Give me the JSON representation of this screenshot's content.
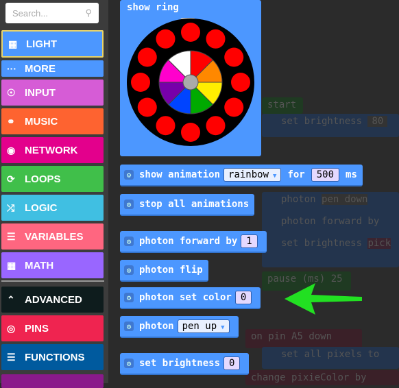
{
  "search": {
    "placeholder": "Search...",
    "icon": "search-icon"
  },
  "categories": [
    {
      "label": "LIGHT",
      "icon": "grid-icon",
      "color": "#4c97ff",
      "selected": true
    },
    {
      "label": "MORE",
      "icon": "more-icon",
      "color": "#4c97ff"
    },
    {
      "label": "INPUT",
      "icon": "target-icon",
      "color": "#d65cd6"
    },
    {
      "label": "MUSIC",
      "icon": "headphones-icon",
      "color": "#fe6330"
    },
    {
      "label": "NETWORK",
      "icon": "chat-icon",
      "color": "#e3008c"
    },
    {
      "label": "LOOPS",
      "icon": "refresh-icon",
      "color": "#40bf4a"
    },
    {
      "label": "LOGIC",
      "icon": "shuffle-icon",
      "color": "#40bfe2"
    },
    {
      "label": "VARIABLES",
      "icon": "list-icon",
      "color": "#ff6680"
    },
    {
      "label": "MATH",
      "icon": "calculator-icon",
      "color": "#9966ff"
    },
    {
      "label": "ADVANCED",
      "icon": "chevron-up-icon",
      "color": "#0e1c1d"
    },
    {
      "label": "PINS",
      "icon": "pins-icon",
      "color": "#ef2450"
    },
    {
      "label": "FUNCTIONS",
      "icon": "functions-icon",
      "color": "#005a9e"
    }
  ],
  "blocks": {
    "show_ring": "show ring",
    "show_animation": {
      "label": "show animation",
      "value": "rainbow",
      "for": "for",
      "ms_value": "500",
      "ms": "ms"
    },
    "stop_all": "stop all animations",
    "forward": {
      "label": "photon forward by",
      "value": "1"
    },
    "flip": "photon flip",
    "set_color": {
      "label": "photon set color",
      "value": "0"
    },
    "pen": {
      "label": "photon",
      "value": "pen up"
    },
    "brightness": {
      "label": "set brightness",
      "value": "0"
    }
  },
  "background_blocks": [
    "start",
    "set brightness",
    "80",
    "photon",
    "pen down",
    "photon forward by",
    "set brightness",
    "pick",
    "pause (ms)",
    "25",
    "on",
    "pin A5",
    "down",
    "set all pixels to",
    "change",
    "pixieColor",
    "by"
  ],
  "arrow_color": "#22e022"
}
